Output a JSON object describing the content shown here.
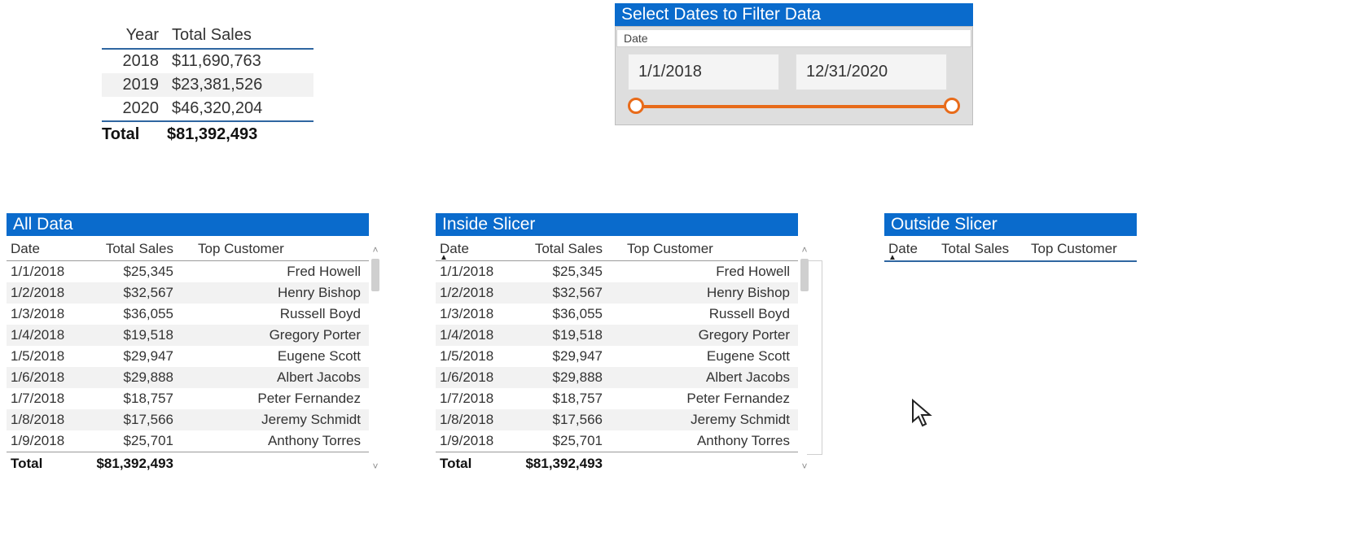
{
  "colors": {
    "accent_blue": "#0a6bcc",
    "slider_orange": "#e86b1a",
    "header_underline": "#2f66a1"
  },
  "summary": {
    "headers": {
      "year": "Year",
      "total_sales": "Total Sales"
    },
    "rows": [
      {
        "year": "2018",
        "total_sales": "$11,690,763"
      },
      {
        "year": "2019",
        "total_sales": "$23,381,526"
      },
      {
        "year": "2020",
        "total_sales": "$46,320,204"
      }
    ],
    "total_label": "Total",
    "total_value": "$81,392,493"
  },
  "date_slicer": {
    "title": "Select Dates to Filter Data",
    "field_label": "Date",
    "from": "1/1/2018",
    "to": "12/31/2020"
  },
  "columns": {
    "date": "Date",
    "total_sales": "Total Sales",
    "top_customer": "Top Customer"
  },
  "row_total_label": "Total",
  "all_data": {
    "title": "All Data",
    "total": "$81,392,493",
    "rows": [
      {
        "date": "1/1/2018",
        "total_sales": "$25,345",
        "top_customer": "Fred Howell"
      },
      {
        "date": "1/2/2018",
        "total_sales": "$32,567",
        "top_customer": "Henry Bishop"
      },
      {
        "date": "1/3/2018",
        "total_sales": "$36,055",
        "top_customer": "Russell Boyd"
      },
      {
        "date": "1/4/2018",
        "total_sales": "$19,518",
        "top_customer": "Gregory Porter"
      },
      {
        "date": "1/5/2018",
        "total_sales": "$29,947",
        "top_customer": "Eugene Scott"
      },
      {
        "date": "1/6/2018",
        "total_sales": "$29,888",
        "top_customer": "Albert Jacobs"
      },
      {
        "date": "1/7/2018",
        "total_sales": "$18,757",
        "top_customer": "Peter Fernandez"
      },
      {
        "date": "1/8/2018",
        "total_sales": "$17,566",
        "top_customer": "Jeremy Schmidt"
      },
      {
        "date": "1/9/2018",
        "total_sales": "$25,701",
        "top_customer": "Anthony Torres"
      }
    ]
  },
  "inside_slicer": {
    "title": "Inside Slicer",
    "total": "$81,392,493",
    "rows": [
      {
        "date": "1/1/2018",
        "total_sales": "$25,345",
        "top_customer": "Fred Howell"
      },
      {
        "date": "1/2/2018",
        "total_sales": "$32,567",
        "top_customer": "Henry Bishop"
      },
      {
        "date": "1/3/2018",
        "total_sales": "$36,055",
        "top_customer": "Russell Boyd"
      },
      {
        "date": "1/4/2018",
        "total_sales": "$19,518",
        "top_customer": "Gregory Porter"
      },
      {
        "date": "1/5/2018",
        "total_sales": "$29,947",
        "top_customer": "Eugene Scott"
      },
      {
        "date": "1/6/2018",
        "total_sales": "$29,888",
        "top_customer": "Albert Jacobs"
      },
      {
        "date": "1/7/2018",
        "total_sales": "$18,757",
        "top_customer": "Peter Fernandez"
      },
      {
        "date": "1/8/2018",
        "total_sales": "$17,566",
        "top_customer": "Jeremy Schmidt"
      },
      {
        "date": "1/9/2018",
        "total_sales": "$25,701",
        "top_customer": "Anthony Torres"
      }
    ]
  },
  "outside_slicer": {
    "title": "Outside Slicer",
    "rows": []
  },
  "chart_data": [
    {
      "type": "table",
      "title": "Year vs Total Sales",
      "columns": [
        "Year",
        "Total Sales"
      ],
      "rows": [
        [
          "2018",
          11690763
        ],
        [
          "2019",
          23381526
        ],
        [
          "2020",
          46320204
        ]
      ],
      "total": 81392493
    }
  ]
}
